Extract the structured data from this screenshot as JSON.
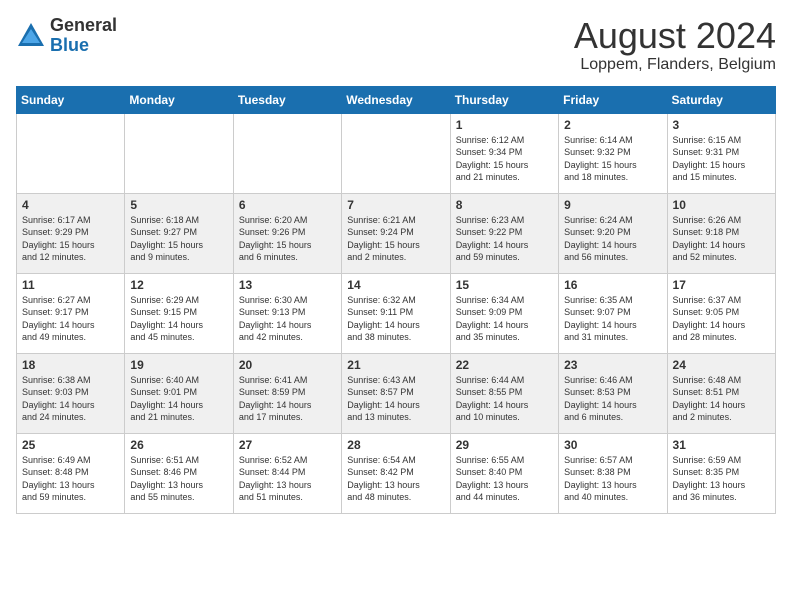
{
  "header": {
    "logo_general": "General",
    "logo_blue": "Blue",
    "month_year": "August 2024",
    "location": "Loppem, Flanders, Belgium"
  },
  "weekdays": [
    "Sunday",
    "Monday",
    "Tuesday",
    "Wednesday",
    "Thursday",
    "Friday",
    "Saturday"
  ],
  "weeks": [
    [
      {
        "day": "",
        "info": ""
      },
      {
        "day": "",
        "info": ""
      },
      {
        "day": "",
        "info": ""
      },
      {
        "day": "",
        "info": ""
      },
      {
        "day": "1",
        "info": "Sunrise: 6:12 AM\nSunset: 9:34 PM\nDaylight: 15 hours\nand 21 minutes."
      },
      {
        "day": "2",
        "info": "Sunrise: 6:14 AM\nSunset: 9:32 PM\nDaylight: 15 hours\nand 18 minutes."
      },
      {
        "day": "3",
        "info": "Sunrise: 6:15 AM\nSunset: 9:31 PM\nDaylight: 15 hours\nand 15 minutes."
      }
    ],
    [
      {
        "day": "4",
        "info": "Sunrise: 6:17 AM\nSunset: 9:29 PM\nDaylight: 15 hours\nand 12 minutes."
      },
      {
        "day": "5",
        "info": "Sunrise: 6:18 AM\nSunset: 9:27 PM\nDaylight: 15 hours\nand 9 minutes."
      },
      {
        "day": "6",
        "info": "Sunrise: 6:20 AM\nSunset: 9:26 PM\nDaylight: 15 hours\nand 6 minutes."
      },
      {
        "day": "7",
        "info": "Sunrise: 6:21 AM\nSunset: 9:24 PM\nDaylight: 15 hours\nand 2 minutes."
      },
      {
        "day": "8",
        "info": "Sunrise: 6:23 AM\nSunset: 9:22 PM\nDaylight: 14 hours\nand 59 minutes."
      },
      {
        "day": "9",
        "info": "Sunrise: 6:24 AM\nSunset: 9:20 PM\nDaylight: 14 hours\nand 56 minutes."
      },
      {
        "day": "10",
        "info": "Sunrise: 6:26 AM\nSunset: 9:18 PM\nDaylight: 14 hours\nand 52 minutes."
      }
    ],
    [
      {
        "day": "11",
        "info": "Sunrise: 6:27 AM\nSunset: 9:17 PM\nDaylight: 14 hours\nand 49 minutes."
      },
      {
        "day": "12",
        "info": "Sunrise: 6:29 AM\nSunset: 9:15 PM\nDaylight: 14 hours\nand 45 minutes."
      },
      {
        "day": "13",
        "info": "Sunrise: 6:30 AM\nSunset: 9:13 PM\nDaylight: 14 hours\nand 42 minutes."
      },
      {
        "day": "14",
        "info": "Sunrise: 6:32 AM\nSunset: 9:11 PM\nDaylight: 14 hours\nand 38 minutes."
      },
      {
        "day": "15",
        "info": "Sunrise: 6:34 AM\nSunset: 9:09 PM\nDaylight: 14 hours\nand 35 minutes."
      },
      {
        "day": "16",
        "info": "Sunrise: 6:35 AM\nSunset: 9:07 PM\nDaylight: 14 hours\nand 31 minutes."
      },
      {
        "day": "17",
        "info": "Sunrise: 6:37 AM\nSunset: 9:05 PM\nDaylight: 14 hours\nand 28 minutes."
      }
    ],
    [
      {
        "day": "18",
        "info": "Sunrise: 6:38 AM\nSunset: 9:03 PM\nDaylight: 14 hours\nand 24 minutes."
      },
      {
        "day": "19",
        "info": "Sunrise: 6:40 AM\nSunset: 9:01 PM\nDaylight: 14 hours\nand 21 minutes."
      },
      {
        "day": "20",
        "info": "Sunrise: 6:41 AM\nSunset: 8:59 PM\nDaylight: 14 hours\nand 17 minutes."
      },
      {
        "day": "21",
        "info": "Sunrise: 6:43 AM\nSunset: 8:57 PM\nDaylight: 14 hours\nand 13 minutes."
      },
      {
        "day": "22",
        "info": "Sunrise: 6:44 AM\nSunset: 8:55 PM\nDaylight: 14 hours\nand 10 minutes."
      },
      {
        "day": "23",
        "info": "Sunrise: 6:46 AM\nSunset: 8:53 PM\nDaylight: 14 hours\nand 6 minutes."
      },
      {
        "day": "24",
        "info": "Sunrise: 6:48 AM\nSunset: 8:51 PM\nDaylight: 14 hours\nand 2 minutes."
      }
    ],
    [
      {
        "day": "25",
        "info": "Sunrise: 6:49 AM\nSunset: 8:48 PM\nDaylight: 13 hours\nand 59 minutes."
      },
      {
        "day": "26",
        "info": "Sunrise: 6:51 AM\nSunset: 8:46 PM\nDaylight: 13 hours\nand 55 minutes."
      },
      {
        "day": "27",
        "info": "Sunrise: 6:52 AM\nSunset: 8:44 PM\nDaylight: 13 hours\nand 51 minutes."
      },
      {
        "day": "28",
        "info": "Sunrise: 6:54 AM\nSunset: 8:42 PM\nDaylight: 13 hours\nand 48 minutes."
      },
      {
        "day": "29",
        "info": "Sunrise: 6:55 AM\nSunset: 8:40 PM\nDaylight: 13 hours\nand 44 minutes."
      },
      {
        "day": "30",
        "info": "Sunrise: 6:57 AM\nSunset: 8:38 PM\nDaylight: 13 hours\nand 40 minutes."
      },
      {
        "day": "31",
        "info": "Sunrise: 6:59 AM\nSunset: 8:35 PM\nDaylight: 13 hours\nand 36 minutes."
      }
    ]
  ]
}
